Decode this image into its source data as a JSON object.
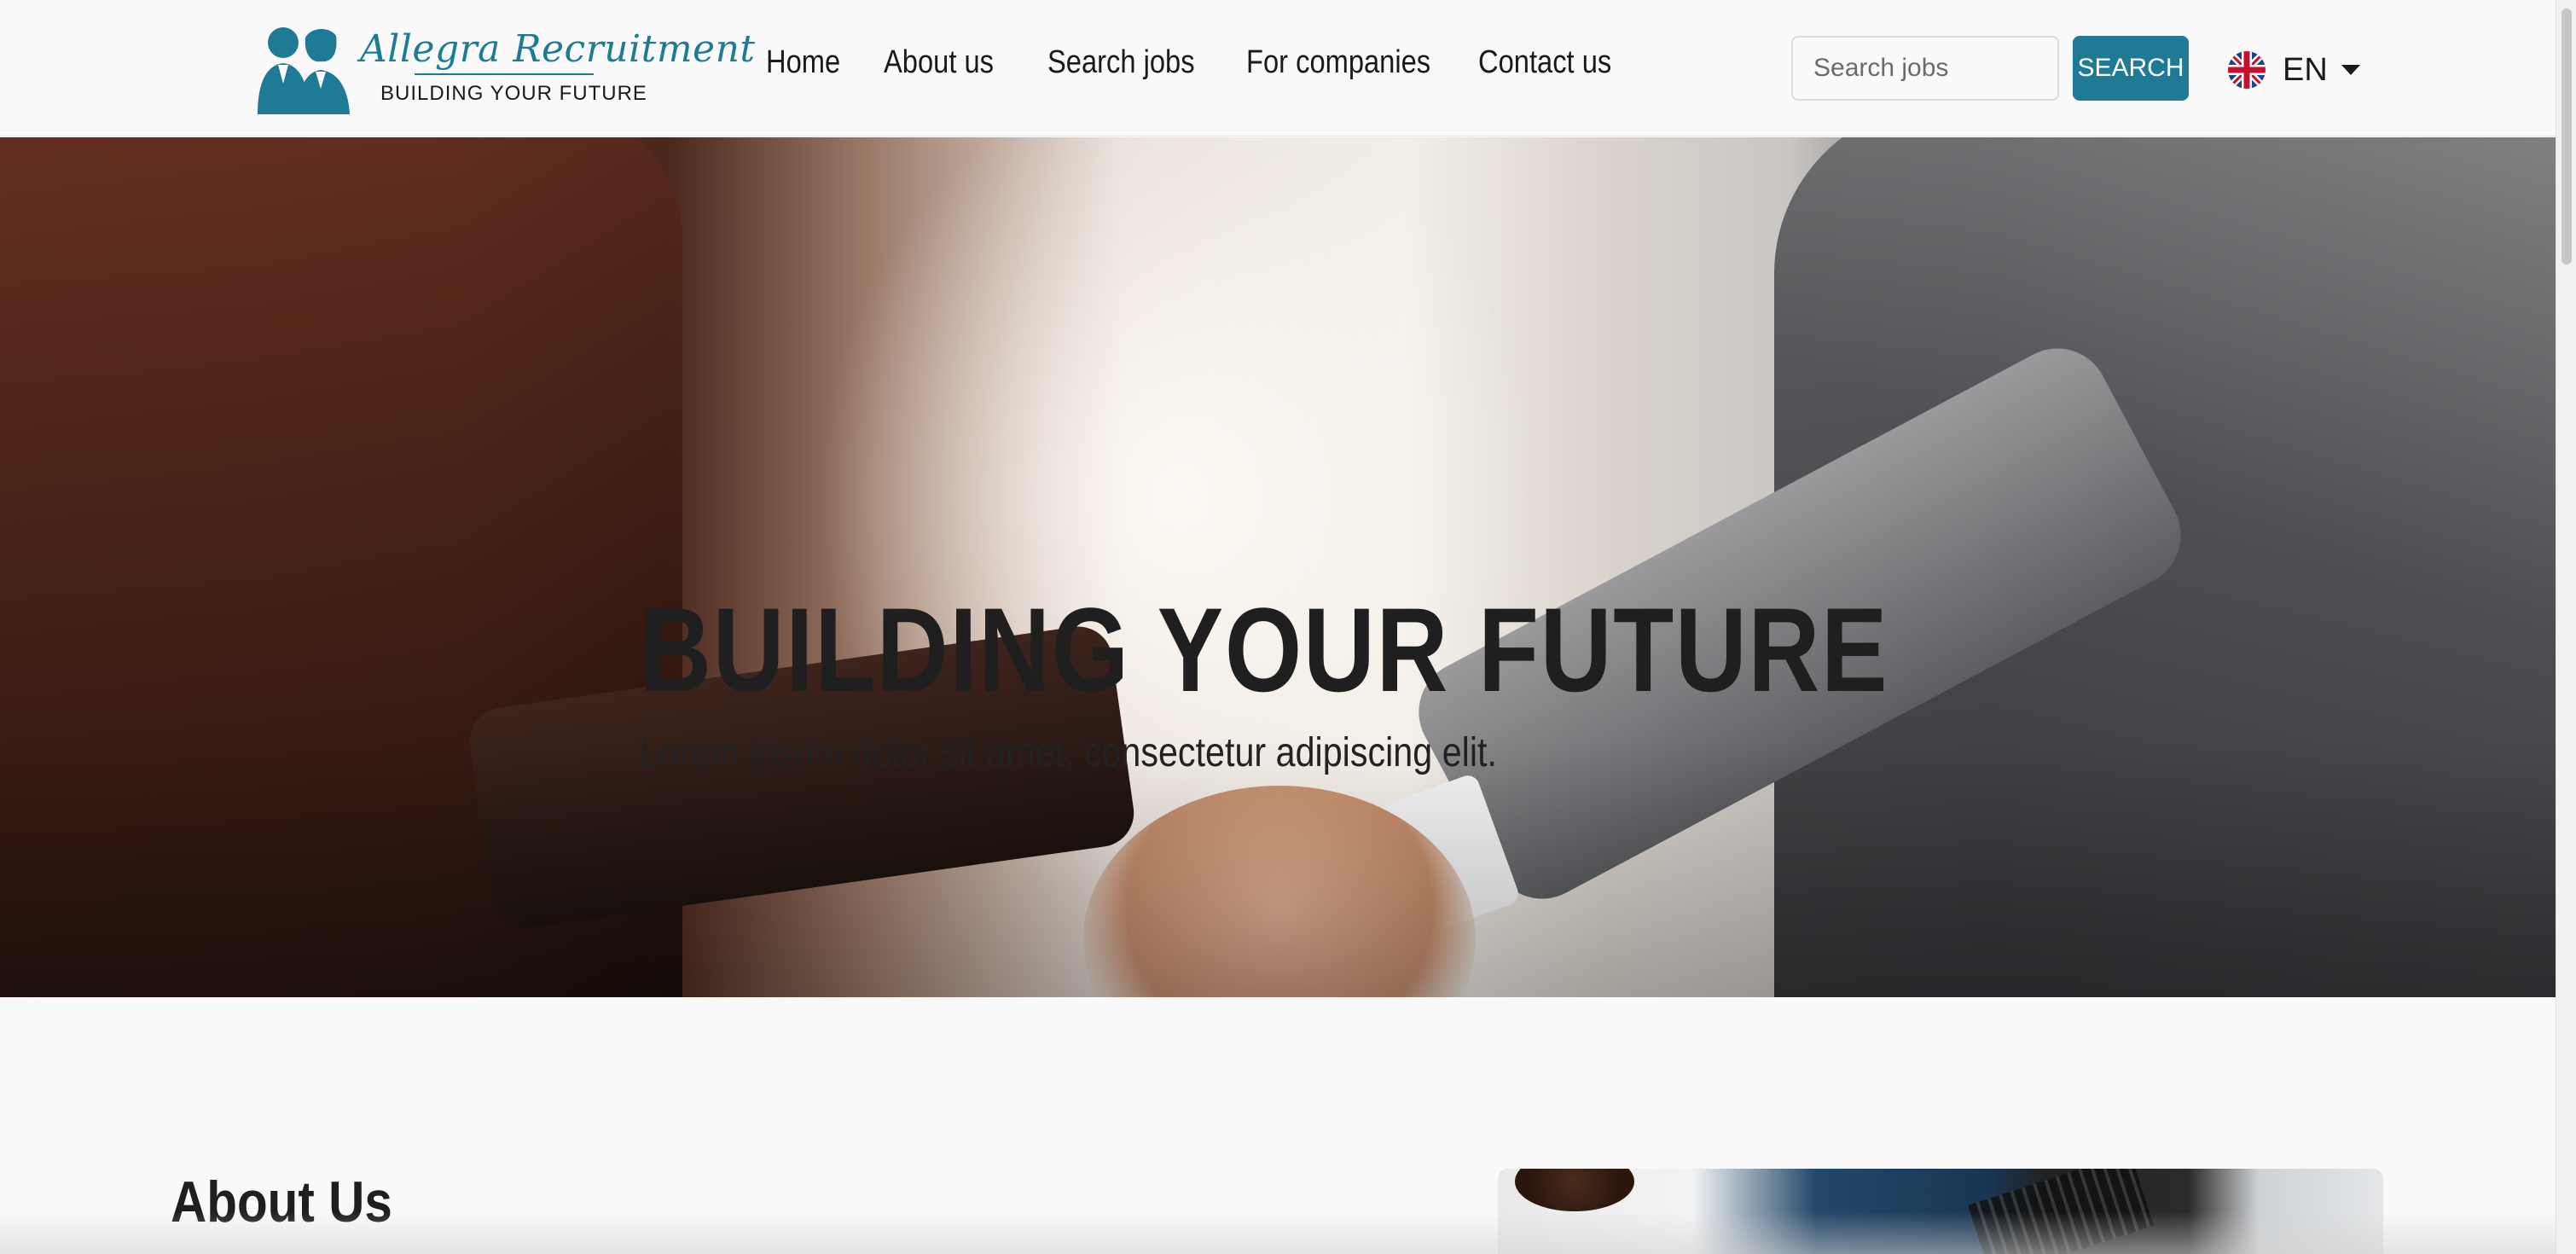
{
  "brand": {
    "name": "Allegra Recruitment",
    "tagline": "BUILDING YOUR FUTURE",
    "color": "#1f7a95"
  },
  "nav": {
    "items": [
      {
        "label": "Home"
      },
      {
        "label": "About us"
      },
      {
        "label": "Search jobs"
      },
      {
        "label": "For companies"
      },
      {
        "label": "Contact us"
      }
    ]
  },
  "search": {
    "placeholder": "Search jobs",
    "value": "",
    "button_label": "SEARCH"
  },
  "language": {
    "code": "EN",
    "flag_icon": "uk-flag-icon"
  },
  "hero": {
    "title": "BUILDING YOUR FUTURE",
    "subtitle": "Lorem ipsum dolor sit amet, consectetur adipiscing elit."
  },
  "about": {
    "heading": "About Us"
  }
}
